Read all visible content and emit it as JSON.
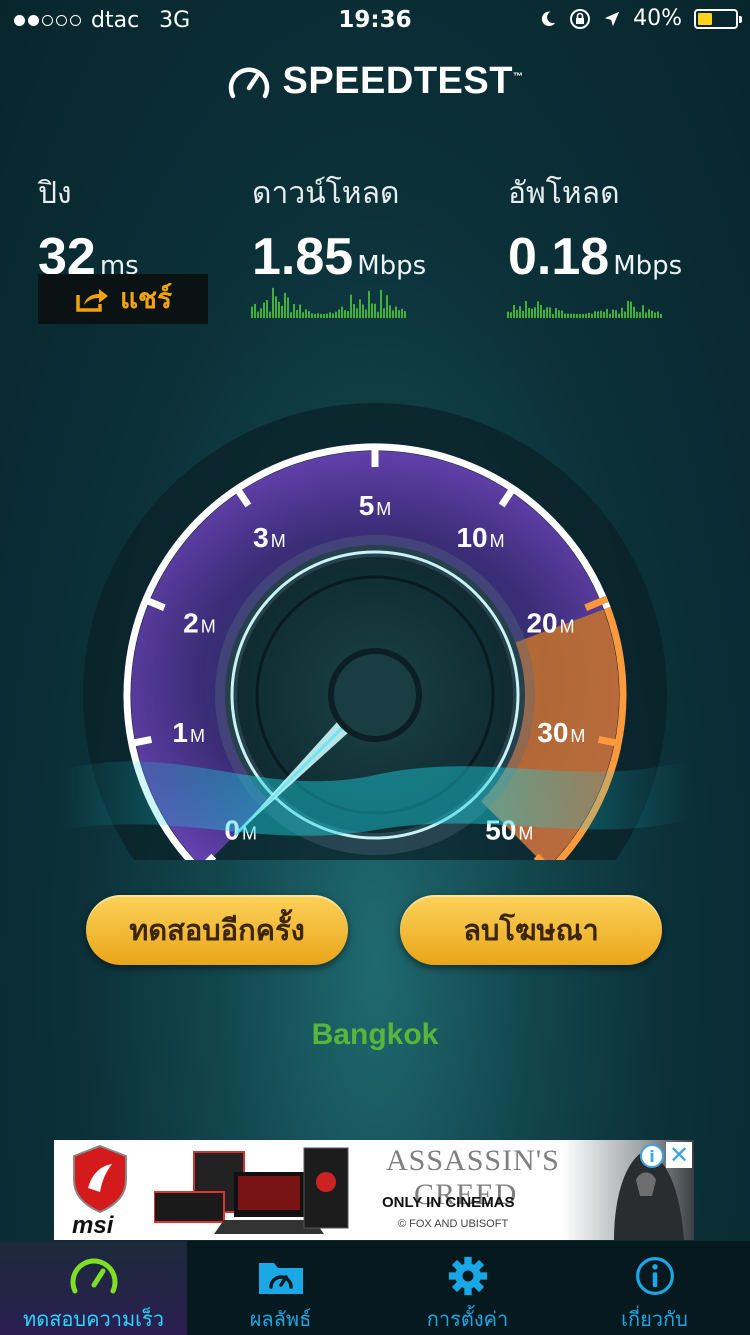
{
  "status_bar": {
    "carrier": "dtac",
    "network": "3G",
    "time": "19:36",
    "battery": "40%",
    "battery_level": 0.4
  },
  "header": {
    "title": "SPEEDTEST",
    "trademark": "™"
  },
  "stats": {
    "ping": {
      "label": "ปิง",
      "value": "32",
      "unit": "ms"
    },
    "download": {
      "label": "ดาวน์โหลด",
      "value": "1.85",
      "unit": "Mbps"
    },
    "upload": {
      "label": "อัพโหลด",
      "value": "0.18",
      "unit": "Mbps"
    }
  },
  "share": {
    "label": "แชร์"
  },
  "gauge": {
    "ticks": [
      {
        "num": "0",
        "unit": "M"
      },
      {
        "num": "1",
        "unit": "M"
      },
      {
        "num": "2",
        "unit": "M"
      },
      {
        "num": "3",
        "unit": "M"
      },
      {
        "num": "5",
        "unit": "M"
      },
      {
        "num": "10",
        "unit": "M"
      },
      {
        "num": "20",
        "unit": "M"
      },
      {
        "num": "30",
        "unit": "M"
      },
      {
        "num": "50",
        "unit": "M"
      }
    ],
    "needle_value_mbps": 0
  },
  "actions": {
    "retest": "ทดสอบอีกครั้ง",
    "remove_ads": "ลบโฆษณา"
  },
  "location": "Bangkok",
  "ad": {
    "left_brand": "msi",
    "right_title_line1": "ASSASSIN'S",
    "right_title_line2": "CREED",
    "right_tagline": "ONLY IN CINEMAS",
    "right_credit": "© FOX AND UBISOFT",
    "info_symbol": "i",
    "close_symbol": "✕"
  },
  "tabs": [
    {
      "label": "ทดสอบความเร็ว",
      "icon": "speedometer-icon",
      "active": true
    },
    {
      "label": "ผลลัพธ์",
      "icon": "results-folder-icon",
      "active": false
    },
    {
      "label": "การตั้งค่า",
      "icon": "gear-icon",
      "active": false
    },
    {
      "label": "เกี่ยวกับ",
      "icon": "info-icon",
      "active": false
    }
  ],
  "colors": {
    "accent_orange": "#f0a30a",
    "tab_blue": "#1aa7e6",
    "location_green": "#58b73a",
    "button_gold": "#f4bd35"
  }
}
